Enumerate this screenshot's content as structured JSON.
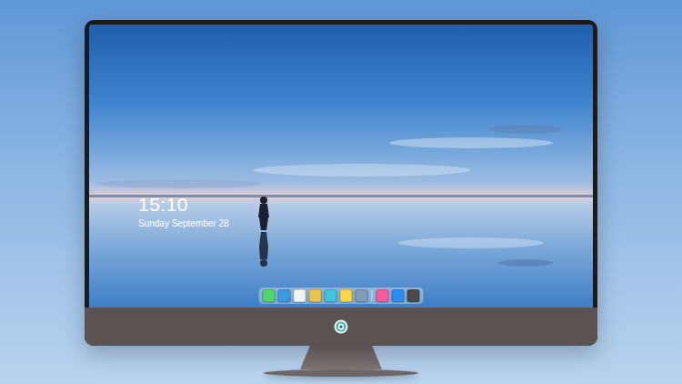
{
  "lock_screen": {
    "time": "15:10",
    "date": "Sunday September 28"
  },
  "dock": {
    "apps": [
      {
        "color": "#4cd964"
      },
      {
        "color": "#3b9ae1"
      },
      {
        "color": "#f4f4f4"
      },
      {
        "color": "#e9c44a"
      },
      {
        "color": "#3ec5e0"
      },
      {
        "color": "#f7d64a"
      },
      {
        "color": "#7f9db5"
      },
      {
        "color": "#f25c9b"
      },
      {
        "color": "#2a8cf0"
      },
      {
        "color": "#4a4a4a"
      }
    ]
  }
}
